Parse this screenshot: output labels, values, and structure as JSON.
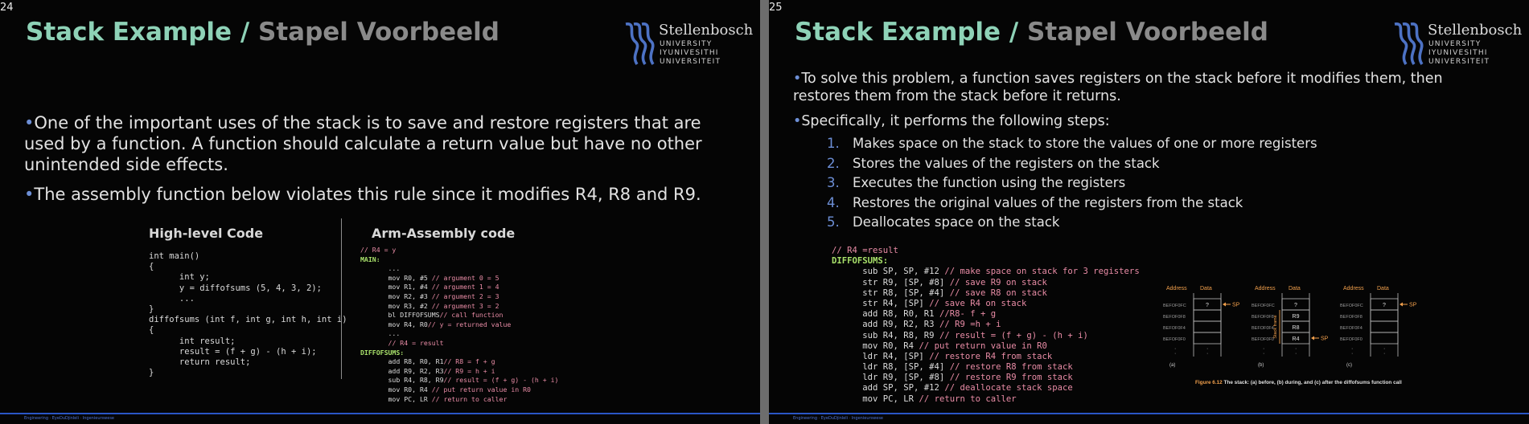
{
  "slides": {
    "s24": {
      "number": "24",
      "title_en": "Stack Example /",
      "title_af": "Stapel Voorbeeld",
      "bullets": [
        "One of the important uses of the stack is to save and restore registers that are used by a function. A function should calculate a return value but have no other unintended side effects.",
        "The assembly function below violates this rule since it modifies R4, R8 and R9."
      ],
      "high_level": {
        "heading": "High-level Code",
        "lines": [
          "int main()",
          "{",
          "      int y;",
          "      y = diffofsums (5, 4, 3, 2);",
          "      ...",
          "}",
          "diffofsums (int f, int g, int h, int i)",
          "{",
          "      int result;",
          "      result = (f + g) - (h + i);",
          "      return result;",
          "}"
        ]
      },
      "assembly": {
        "heading": "Arm-Assembly code",
        "lines": [
          {
            "code": "",
            "comment": "// R4 = y",
            "label": ""
          },
          {
            "code": "",
            "comment": "",
            "label": "MAIN:"
          },
          {
            "code": "       ...",
            "comment": "",
            "label": ""
          },
          {
            "code": "       mov R0, #5 ",
            "comment": "// argument 0 = 5",
            "label": ""
          },
          {
            "code": "       mov R1, #4 ",
            "comment": "// argument 1 = 4",
            "label": ""
          },
          {
            "code": "       mov R2, #3 ",
            "comment": "// argument 2 = 3",
            "label": ""
          },
          {
            "code": "       mov R3, #2 ",
            "comment": "// argument 3 = 2",
            "label": ""
          },
          {
            "code": "       bl DIFFOFSUMS",
            "comment": "// call function",
            "label": ""
          },
          {
            "code": "       mov R4, R0",
            "comment": "// y = returned value",
            "label": ""
          },
          {
            "code": "       ...",
            "comment": "",
            "label": ""
          },
          {
            "code": "       ",
            "comment": "// R4 = result",
            "label": ""
          },
          {
            "code": "",
            "comment": "",
            "label": "DIFFOFSUMS:"
          },
          {
            "code": "       add R8, R0, R1",
            "comment": "// R8 = f + g",
            "label": ""
          },
          {
            "code": "       add R9, R2, R3",
            "comment": "// R9 = h + i",
            "label": ""
          },
          {
            "code": "       sub R4, R8, R9",
            "comment": "// result = (f + g) - (h + i)",
            "label": ""
          },
          {
            "code": "       mov R0, R4 ",
            "comment": "// put return value in R0",
            "label": ""
          },
          {
            "code": "       mov PC, LR ",
            "comment": "// return to caller",
            "label": ""
          }
        ]
      },
      "footer": "Engineering · EyeDuDjinleli · Ingenieurswese"
    },
    "s25": {
      "number": "25",
      "title_en": "Stack Example /",
      "title_af": "Stapel Voorbeeld",
      "bullets": [
        "To solve this problem, a function saves registers on the stack before it modifies them, then restores them from the stack before it returns.",
        "Specifically, it performs the following steps:"
      ],
      "steps": [
        {
          "n": "1.",
          "text": "Makes space on the stack to store the values of one or more registers"
        },
        {
          "n": "2.",
          "text": "Stores the values of the registers on the stack"
        },
        {
          "n": "3.",
          "text": "Executes the function using the registers"
        },
        {
          "n": "4.",
          "text": "Restores the original values of the registers from the stack"
        },
        {
          "n": "5.",
          "text": "Deallocates space on the stack"
        }
      ],
      "assembly": [
        {
          "code": "",
          "comment": "// R4 =result",
          "label": ""
        },
        {
          "code": "",
          "comment": "",
          "label": "DIFFOFSUMS:"
        },
        {
          "code": "      sub SP, SP, #12 ",
          "comment": "// make space on stack for 3 registers",
          "label": ""
        },
        {
          "code": "      str R9, [SP, #8] ",
          "comment": "// save R9 on stack",
          "label": ""
        },
        {
          "code": "      str R8, [SP, #4] ",
          "comment": "// save R8 on stack",
          "label": ""
        },
        {
          "code": "      str R4, [SP] ",
          "comment": "// save R4 on stack",
          "label": ""
        },
        {
          "code": "      add R8, R0, R1 ",
          "comment": "//R8- f + g",
          "label": ""
        },
        {
          "code": "      add R9, R2, R3 ",
          "comment": "// R9 =h + i",
          "label": ""
        },
        {
          "code": "      sub R4, R8, R9 ",
          "comment": "// result = (f + g) - (h + i)",
          "label": ""
        },
        {
          "code": "      mov R0, R4 ",
          "comment": "// put return value in R0",
          "label": ""
        },
        {
          "code": "      ldr R4, [SP] ",
          "comment": "// restore R4 from stack",
          "label": ""
        },
        {
          "code": "      ldr R8, [SP, #4] ",
          "comment": "// restore R8 from stack",
          "label": ""
        },
        {
          "code": "      ldr R9, [SP, #8] ",
          "comment": "// restore R9 from stack",
          "label": ""
        },
        {
          "code": "      add SP, SP, #12 ",
          "comment": "// deallocate stack space",
          "label": ""
        },
        {
          "code": "      mov PC, LR ",
          "comment": "// return to caller",
          "label": ""
        }
      ],
      "figure": {
        "address_label": "Address",
        "data_label": "Data",
        "addresses": [
          "BEFOF0FC",
          "BEFOF0F8",
          "BEFOF0F4",
          "BEFOF0F0"
        ],
        "sp_label": "SP",
        "frame_label": "Stack frame",
        "panels": [
          {
            "tag": "(a)",
            "cells": [
              "?",
              "",
              "",
              ""
            ]
          },
          {
            "tag": "(b)",
            "cells": [
              "?",
              "R9",
              "R8",
              "R4"
            ]
          },
          {
            "tag": "(c)",
            "cells": [
              "?",
              "",
              "",
              ""
            ]
          }
        ],
        "caption_fig": "Figure 6.12",
        "caption_text": "The stack: (a) before, (b) during, and (c) after the diffofsums function call"
      },
      "footer": "Engineering · EyeDuDjinleli · Ingenieurswese"
    }
  },
  "logo": {
    "name": "Stellenbosch",
    "lines": [
      "UNIVERSITY",
      "IYUNIVESITHI",
      "UNIVERSITEIT"
    ]
  },
  "colors": {
    "title_accent": "#8ed2b7",
    "title_gray": "#8a8a8a",
    "bullet": "#6d8fd6",
    "comment": "#e98ca6",
    "label": "#a8e06a",
    "footer_bar": "#2a56c6",
    "fig_orange": "#f2a04c"
  }
}
